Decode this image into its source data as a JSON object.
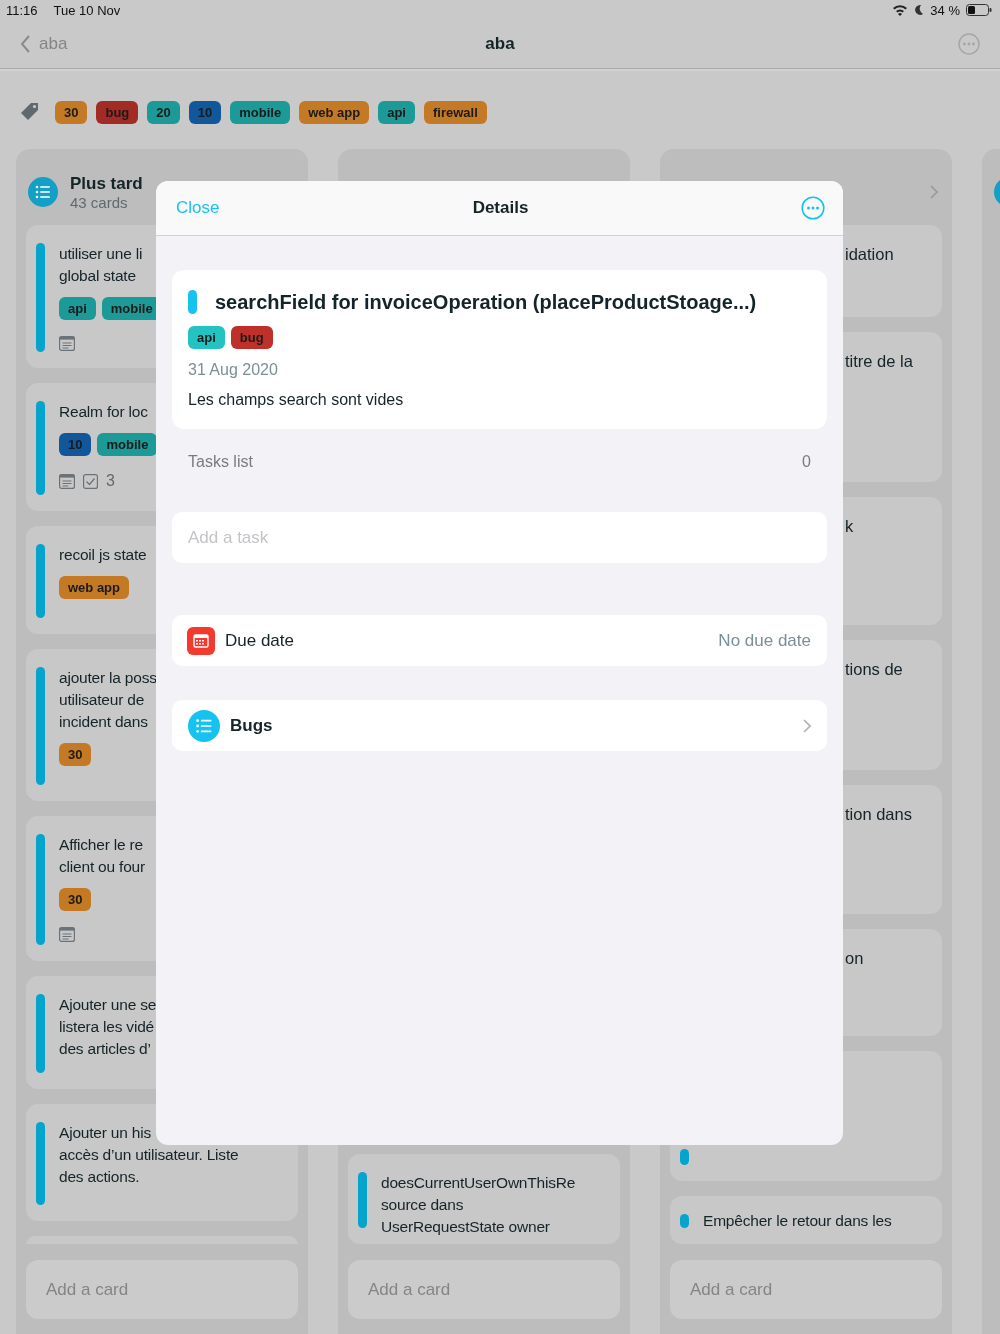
{
  "status_bar": {
    "time": "11:16",
    "date": "Tue 10 Nov",
    "battery": "34 %"
  },
  "nav": {
    "back": "aba",
    "title": "aba"
  },
  "tags": [
    {
      "label": "30",
      "color": "#c47a24"
    },
    {
      "label": "bug",
      "color": "#a32b25"
    },
    {
      "label": "20",
      "color": "#1c9a97"
    },
    {
      "label": "10",
      "color": "#11579a"
    },
    {
      "label": "mobile",
      "color": "#1c9a97"
    },
    {
      "label": "web app",
      "color": "#c47a24"
    },
    {
      "label": "api",
      "color": "#1c9a97"
    },
    {
      "label": "firewall",
      "color": "#c47a24"
    }
  ],
  "columns": [
    {
      "header": {
        "title": "Plus tard",
        "count": "43 cards"
      },
      "cards": [
        {
          "kind": "card",
          "text": "utiliser une li\nglobal state",
          "tags": [
            {
              "label": "api",
              "color": "#1c9a97"
            },
            {
              "label": "mobile",
              "color": "#1c9a97"
            }
          ],
          "notes": true
        },
        {
          "kind": "card",
          "text": "Realm for loc",
          "tags": [
            {
              "label": "10",
              "color": "#11579a"
            },
            {
              "label": "mobile",
              "color": "#1c9a97"
            }
          ],
          "notes": true,
          "checklist": "3"
        },
        {
          "kind": "card",
          "text": "recoil js state",
          "tags": [
            {
              "label": "web app",
              "color": "#c47a24"
            }
          ]
        },
        {
          "kind": "card",
          "text": "ajouter la poss\nutilisateur de\nincident dans",
          "tags": [
            {
              "label": "30",
              "color": "#c47a24"
            }
          ]
        },
        {
          "kind": "card",
          "text": "Afficher le re\nclient ou four",
          "tags": [
            {
              "label": "30",
              "color": "#c47a24"
            }
          ],
          "notes": true
        },
        {
          "kind": "card",
          "text": "Ajouter une se\nlistera les vidé\ndes articles d’"
        },
        {
          "kind": "card",
          "text": "Ajouter un his\naccès d’un utilisateur. Liste\ndes actions."
        },
        {
          "kind": "blank"
        }
      ],
      "add_card": "Add a card"
    },
    {
      "cards": [
        {
          "kind": "card",
          "text": "doesCurrentUserOwnThisRe\nsource dans\nUserRequestState owner"
        }
      ],
      "add_card": "Add a card"
    },
    {
      "chevron": true,
      "cards": [
        {
          "kind": "fragment",
          "text": "idation"
        },
        {
          "kind": "fragment",
          "text": "titre de la"
        },
        {
          "kind": "fragment",
          "text": "k"
        },
        {
          "kind": "fragment",
          "text": "tions de"
        },
        {
          "kind": "fragment",
          "text": "tion dans"
        },
        {
          "kind": "fragment",
          "text": "on"
        },
        {
          "kind": "blank"
        },
        {
          "kind": "card",
          "text": "Empêcher le retour dans les"
        }
      ],
      "add_card": "Add a card"
    }
  ],
  "modal": {
    "close": "Close",
    "title": "Details",
    "card": {
      "title": "searchField for invoiceOperation (placeProductStoage...)",
      "tags": [
        {
          "label": "api",
          "color": "#22c3c1"
        },
        {
          "label": "bug",
          "color": "#c0302b"
        }
      ],
      "date": "31 Aug 2020",
      "description": "Les champs search sont vides"
    },
    "tasks": {
      "label": "Tasks list",
      "count": "0"
    },
    "task_field": {
      "placeholder": "Add a task"
    },
    "due": {
      "label": "Due date",
      "value": "No due date"
    },
    "list": {
      "label": "Bugs"
    }
  }
}
